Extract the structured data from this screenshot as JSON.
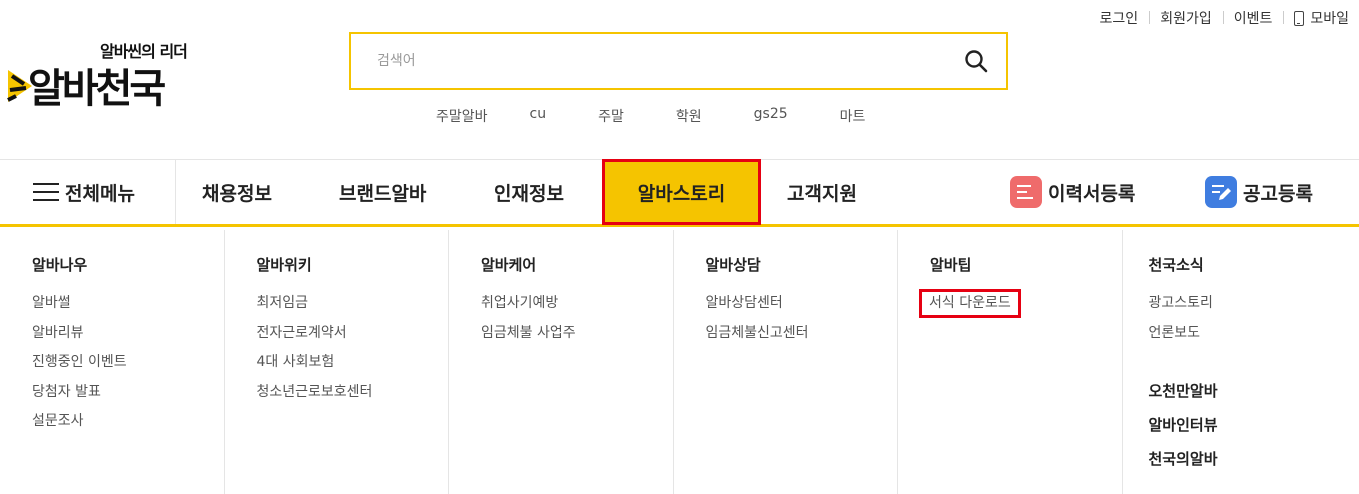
{
  "util_links": {
    "login": "로그인",
    "signup": "회원가입",
    "event": "이벤트",
    "mobile": "모바일"
  },
  "logo": {
    "tagline": "알바씬의 리더",
    "name": "알바천국"
  },
  "search": {
    "placeholder": "검색어"
  },
  "keywords": [
    "주말알바",
    "cu",
    "주말",
    "학원",
    "gs25",
    "마트"
  ],
  "nav": {
    "all_menu": "전체메뉴",
    "items": [
      "채용정보",
      "브랜드알바",
      "인재정보",
      "알바스토리",
      "고객지원"
    ],
    "resume_register": "이력서등록",
    "post_register": "공고등록"
  },
  "colors": {
    "accent": "#f5c400",
    "highlight": "#e60012",
    "resume_icon": "#ef6b6b",
    "post_icon": "#3f7de0"
  },
  "mega": [
    {
      "title": "알바나우",
      "links": [
        "알바썰",
        "알바리뷰",
        "진행중인 이벤트",
        "당첨자 발표",
        "설문조사"
      ]
    },
    {
      "title": "알바위키",
      "links": [
        "최저임금",
        "전자근로계약서",
        "4대 사회보험",
        "청소년근로보호센터"
      ]
    },
    {
      "title": "알바케어",
      "links": [
        "취업사기예방",
        "임금체불 사업주"
      ]
    },
    {
      "title": "알바상담",
      "links": [
        "알바상담센터",
        "임금체불신고센터"
      ]
    },
    {
      "title": "알바팁",
      "links": [
        "서식 다운로드"
      ]
    },
    {
      "title": "천국소식",
      "links": [
        "광고스토리",
        "언론보도"
      ],
      "extra": [
        "오천만알바",
        "알바인터뷰",
        "천국의알바"
      ]
    }
  ]
}
